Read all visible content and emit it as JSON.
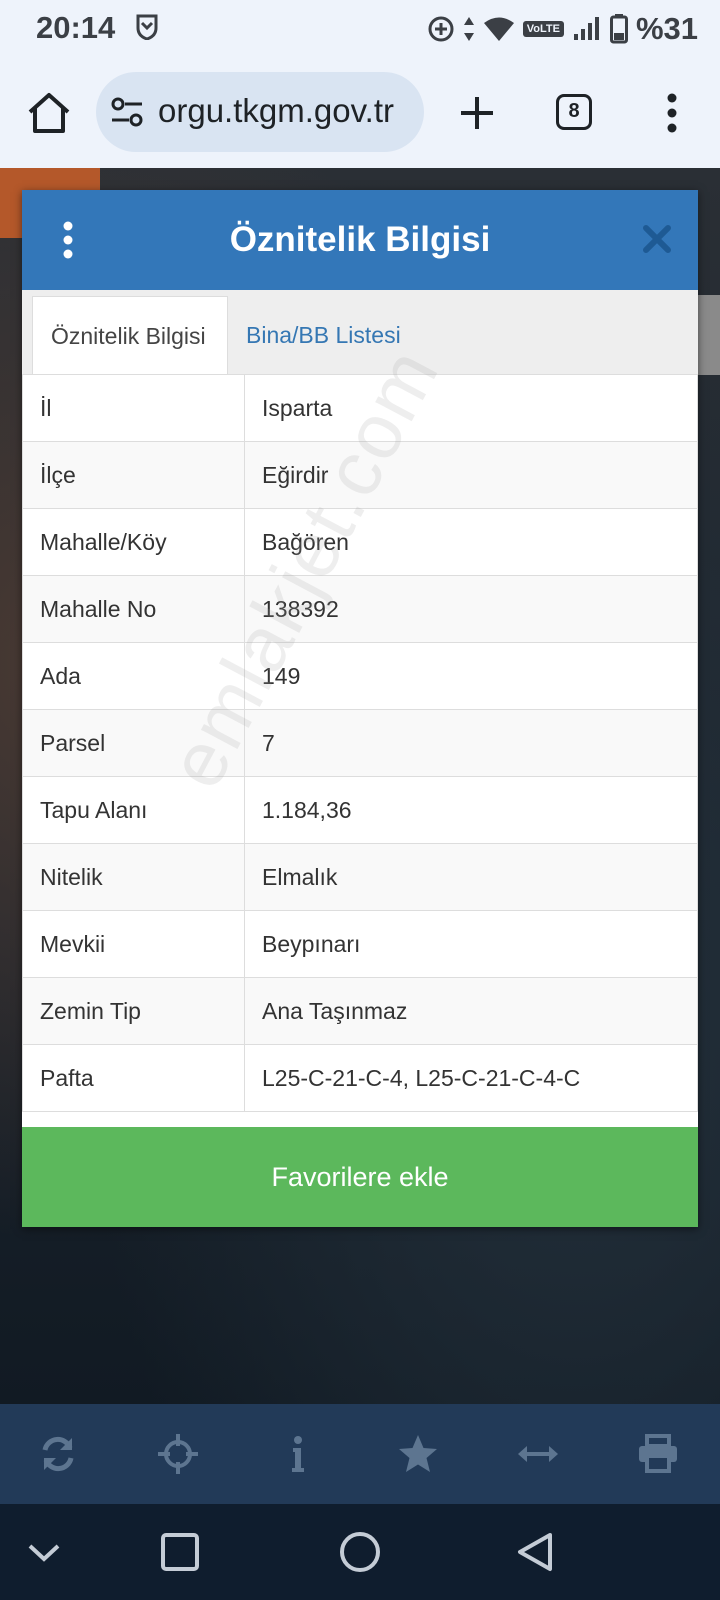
{
  "status_bar": {
    "time": "20:14",
    "network_badge": "VoLTE",
    "battery": "%31"
  },
  "browser": {
    "url": "orgu.tkgm.gov.tr",
    "tab_count": "8"
  },
  "dialog": {
    "title": "Öznitelik Bilgisi",
    "tabs": [
      {
        "label": "Öznitelik Bilgisi",
        "active": true
      },
      {
        "label": "Bina/BB Listesi",
        "active": false
      }
    ],
    "rows": [
      {
        "key": "İl",
        "value": "Isparta"
      },
      {
        "key": "İlçe",
        "value": "Eğirdir"
      },
      {
        "key": "Mahalle/Köy",
        "value": "Bağören"
      },
      {
        "key": "Mahalle No",
        "value": "138392"
      },
      {
        "key": "Ada",
        "value": "149"
      },
      {
        "key": "Parsel",
        "value": "7"
      },
      {
        "key": "Tapu Alanı",
        "value": "1.184,36"
      },
      {
        "key": "Nitelik",
        "value": "Elmalık"
      },
      {
        "key": "Mevkii",
        "value": "Beypınarı"
      },
      {
        "key": "Zemin Tip",
        "value": "Ana Taşınmaz"
      },
      {
        "key": "Pafta",
        "value": "L25-C-21-C-4, L25-C-21-C-4-C"
      }
    ],
    "favorite_button": "Favorilere ekle"
  },
  "watermark": "emlakjet.com",
  "toolbar_icons": [
    "refresh-icon",
    "locate-icon",
    "info-icon",
    "star-icon",
    "measure-icon",
    "print-icon"
  ],
  "colors": {
    "header": "#3377b9",
    "favorite": "#5cb85c",
    "tab_link": "#3577b3",
    "toolbar": "#223a58"
  }
}
